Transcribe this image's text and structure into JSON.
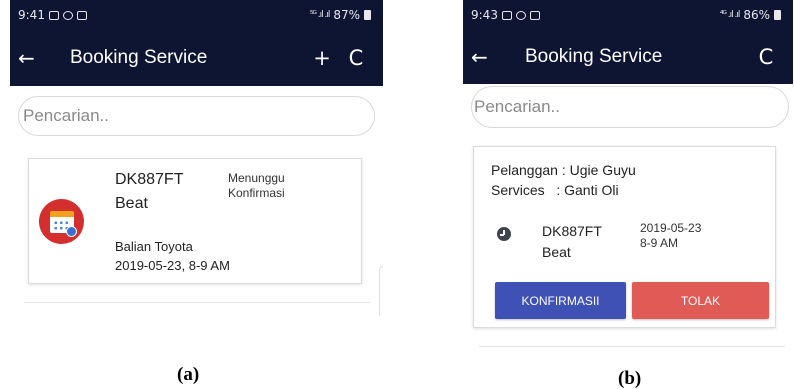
{
  "screen_a": {
    "status_bar": {
      "time": "9:41",
      "signal": "⁵ᴳ .ıl .ıl",
      "battery": "87%"
    },
    "app_bar": {
      "back_icon": "←",
      "title": "Booking Service",
      "add_icon": "+",
      "refresh_icon": "C"
    },
    "search": {
      "placeholder": "Pencarian.."
    },
    "booking": {
      "plate": "DK887FT",
      "vehicle": "Beat",
      "status": "Menunggu Konfirmasi",
      "location": "Balian Toyota",
      "schedule": "2019-05-23, 8-9 AM",
      "icon": "calendar-check-icon"
    },
    "caption": "(a)"
  },
  "screen_b": {
    "status_bar": {
      "time": "9:43",
      "signal": "⁴ᴳ .ıl .ıl",
      "battery": "86%"
    },
    "app_bar": {
      "back_icon": "←",
      "title": "Booking Service",
      "refresh_icon": "C"
    },
    "search": {
      "placeholder": "Pencarian.."
    },
    "booking": {
      "customer_line": "Pelanggan : Ugie Guyu",
      "services_line": "Services   : Ganti Oli",
      "plate": "DK887FT",
      "vehicle": "Beat",
      "date": "2019-05-23",
      "time": "8-9 AM",
      "confirm_label": "KONFIRMASII",
      "reject_label": "TOLAK",
      "icon": "clock-icon"
    },
    "caption": "(b)"
  },
  "colors": {
    "app_bar": "#0e1533",
    "confirm": "#3f51b5",
    "reject": "#e05a56",
    "calendar_badge": "#d32f2f"
  }
}
